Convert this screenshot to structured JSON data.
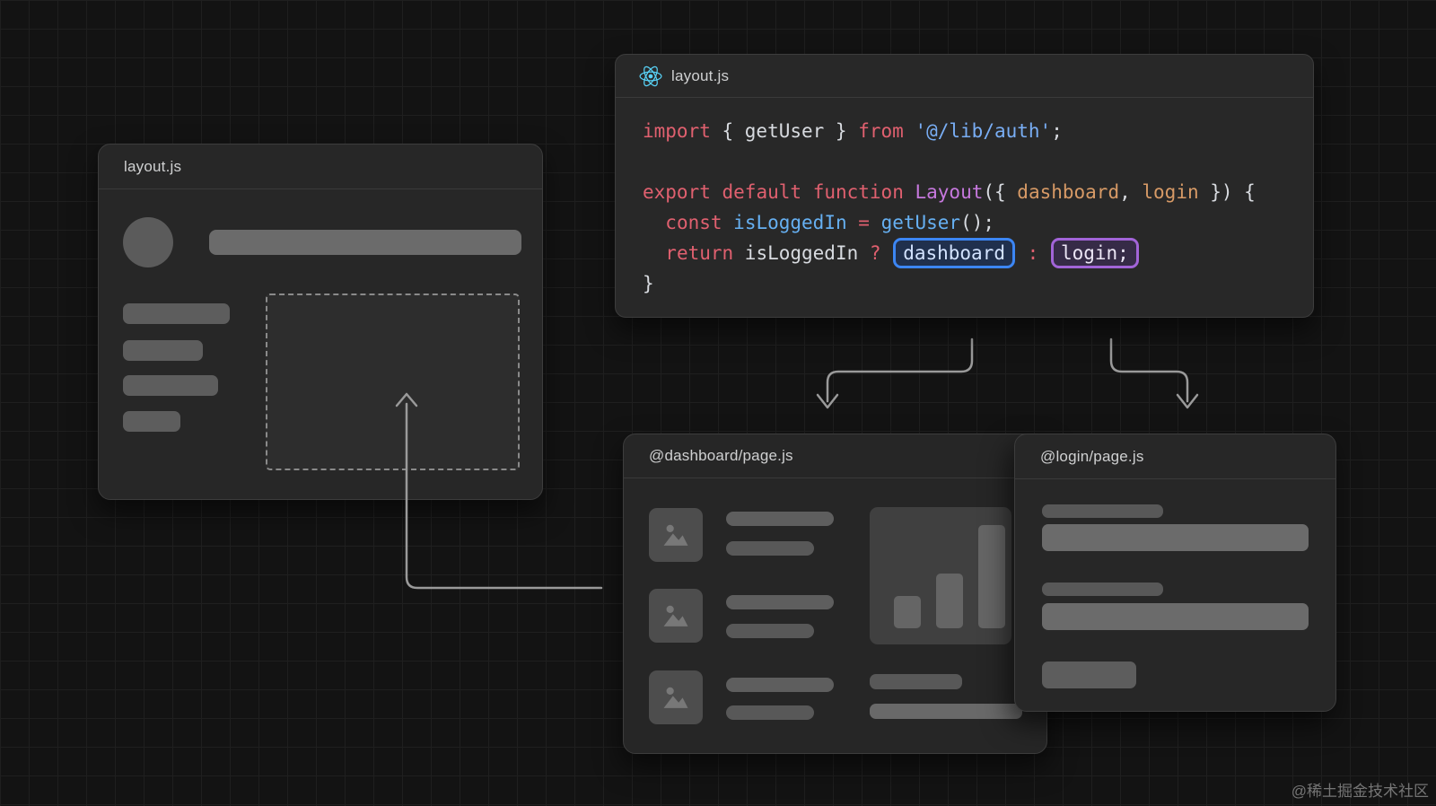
{
  "watermark": "@稀土掘金技术社区",
  "colors": {
    "kw": "#e0606f",
    "pl": "#d8dbe0",
    "str": "#79aef5",
    "fn": "#c678dd",
    "param": "#d79a66",
    "var": "#66b0f2",
    "bb-border": "#3c86f4",
    "bb-bg": "#20304d",
    "bb-text": "#d3e3ff",
    "bp-border": "#a264d8",
    "bp-bg": "#362b47",
    "bp-text": "#ece6f5",
    "react": "#58d2f7",
    "arrow": "#9a9a9a"
  },
  "code_window": {
    "title": "layout.js",
    "icon": "react-logo",
    "code_lines": [
      [
        {
          "t": "import",
          "s": "kw"
        },
        {
          "t": " { getUser } ",
          "s": "pl"
        },
        {
          "t": "from",
          "s": "kw"
        },
        {
          "t": " ",
          "s": "pl"
        },
        {
          "t": "'@/lib/auth'",
          "s": "str"
        },
        {
          "t": ";",
          "s": "pl"
        }
      ],
      [],
      [
        {
          "t": "export",
          "s": "kw"
        },
        {
          "t": " ",
          "s": "pl"
        },
        {
          "t": "default",
          "s": "kw"
        },
        {
          "t": " ",
          "s": "pl"
        },
        {
          "t": "function",
          "s": "kw"
        },
        {
          "t": " ",
          "s": "pl"
        },
        {
          "t": "Layout",
          "s": "fn"
        },
        {
          "t": "({ ",
          "s": "pl"
        },
        {
          "t": "dashboard",
          "s": "param"
        },
        {
          "t": ", ",
          "s": "pl"
        },
        {
          "t": "login",
          "s": "param"
        },
        {
          "t": " }) {",
          "s": "pl"
        }
      ],
      [
        {
          "t": "  ",
          "s": "pl"
        },
        {
          "t": "const",
          "s": "kw"
        },
        {
          "t": " ",
          "s": "pl"
        },
        {
          "t": "isLoggedIn",
          "s": "var"
        },
        {
          "t": " ",
          "s": "pl"
        },
        {
          "t": "=",
          "s": "kw"
        },
        {
          "t": " ",
          "s": "pl"
        },
        {
          "t": "getUser",
          "s": "var"
        },
        {
          "t": "();",
          "s": "pl"
        }
      ],
      [
        {
          "t": "  ",
          "s": "pl"
        },
        {
          "t": "return",
          "s": "kw"
        },
        {
          "t": " isLoggedIn ",
          "s": "pl"
        },
        {
          "t": "?",
          "s": "kw"
        },
        {
          "t": " ",
          "s": "pl"
        },
        {
          "t": "dashboard",
          "s": "box-blue"
        },
        {
          "t": " ",
          "s": "pl"
        },
        {
          "t": ":",
          "s": "kw"
        },
        {
          "t": " ",
          "s": "pl"
        },
        {
          "t": "login;",
          "s": "box-purple"
        }
      ],
      [
        {
          "t": "}",
          "s": "pl"
        }
      ]
    ]
  },
  "layout_window": {
    "title": "layout.js"
  },
  "dashboard_window": {
    "title": "@dashboard/page.js"
  },
  "login_window": {
    "title": "@login/page.js"
  }
}
